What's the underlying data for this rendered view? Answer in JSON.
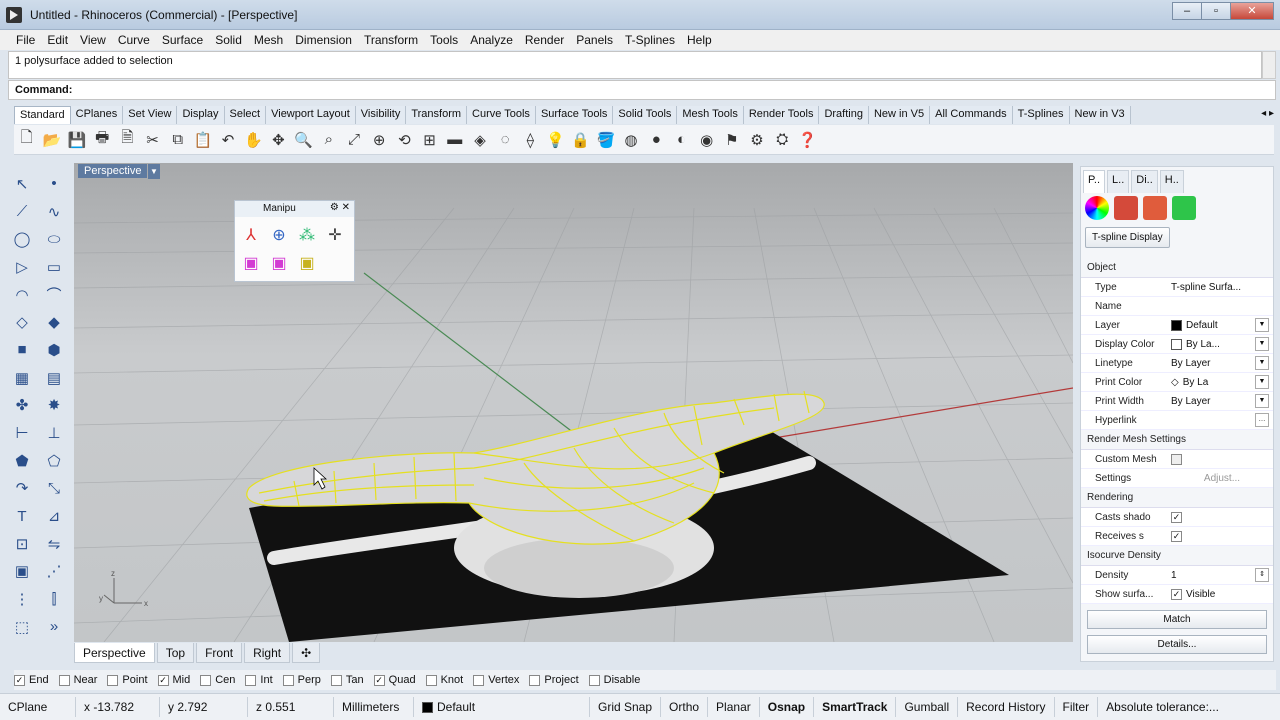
{
  "window": {
    "title": "Untitled - Rhinoceros (Commercial) - [Perspective]"
  },
  "menu": [
    "File",
    "Edit",
    "View",
    "Curve",
    "Surface",
    "Solid",
    "Mesh",
    "Dimension",
    "Transform",
    "Tools",
    "Analyze",
    "Render",
    "Panels",
    "T-Splines",
    "Help"
  ],
  "command": {
    "history": "1 polysurface added to selection",
    "prompt": "Command:"
  },
  "toolbar_tabs": [
    "Standard",
    "CPlanes",
    "Set View",
    "Display",
    "Select",
    "Viewport Layout",
    "Visibility",
    "Transform",
    "Curve Tools",
    "Surface Tools",
    "Solid Tools",
    "Mesh Tools",
    "Render Tools",
    "Drafting",
    "New in V5",
    "All Commands",
    "T-Splines",
    "New in V3"
  ],
  "viewport": {
    "label": "Perspective"
  },
  "manipulators": {
    "title": "Manipu"
  },
  "view_tabs": [
    "Perspective",
    "Top",
    "Front",
    "Right"
  ],
  "panel": {
    "tabs": [
      "P..",
      "L..",
      "Di..",
      "H.."
    ],
    "tspline_display_button": "T-spline Display",
    "object_section": "Object",
    "rows": [
      {
        "k": "Type",
        "v": "T-spline Surfa..."
      },
      {
        "k": "Name",
        "v": ""
      },
      {
        "k": "Layer",
        "v": "Default"
      },
      {
        "k": "Display Color",
        "v": "By La..."
      },
      {
        "k": "Linetype",
        "v": "By Layer"
      },
      {
        "k": "Print Color",
        "v": "By La"
      },
      {
        "k": "Print Width",
        "v": "By Layer"
      },
      {
        "k": "Hyperlink",
        "v": ""
      }
    ],
    "render_mesh_section": "Render Mesh Settings",
    "custom_mesh": "Custom Mesh",
    "settings": "Settings",
    "adjust": "Adjust...",
    "rendering_section": "Rendering",
    "casts_shadows": "Casts shado",
    "receives_shadows": "Receives s",
    "isocurve_section": "Isocurve Density",
    "density_label": "Density",
    "density_value": "1",
    "show_surface": "Show surfa...",
    "visible": "Visible",
    "match_button": "Match",
    "details_button": "Details..."
  },
  "osnap": [
    {
      "label": "End",
      "checked": true
    },
    {
      "label": "Near",
      "checked": false
    },
    {
      "label": "Point",
      "checked": false
    },
    {
      "label": "Mid",
      "checked": true
    },
    {
      "label": "Cen",
      "checked": false
    },
    {
      "label": "Int",
      "checked": false
    },
    {
      "label": "Perp",
      "checked": false
    },
    {
      "label": "Tan",
      "checked": false
    },
    {
      "label": "Quad",
      "checked": true
    },
    {
      "label": "Knot",
      "checked": false
    },
    {
      "label": "Vertex",
      "checked": false
    },
    {
      "label": "Project",
      "checked": false
    },
    {
      "label": "Disable",
      "checked": false
    }
  ],
  "status": {
    "cplane": "CPlane",
    "x": "x -13.782",
    "y": "y 2.792",
    "z": "z 0.551",
    "units": "Millimeters",
    "layer": "Default",
    "grid_snap": "Grid Snap",
    "ortho": "Ortho",
    "planar": "Planar",
    "osnap": "Osnap",
    "smarttrack": "SmartTrack",
    "gumball": "Gumball",
    "record_history": "Record History",
    "filter": "Filter",
    "tolerance": "Absolute tolerance:..."
  },
  "colors": {
    "accent": "#5e7aa0",
    "wire": "#e5e020",
    "ground": "#111111",
    "rope": "#dcdcdc"
  }
}
